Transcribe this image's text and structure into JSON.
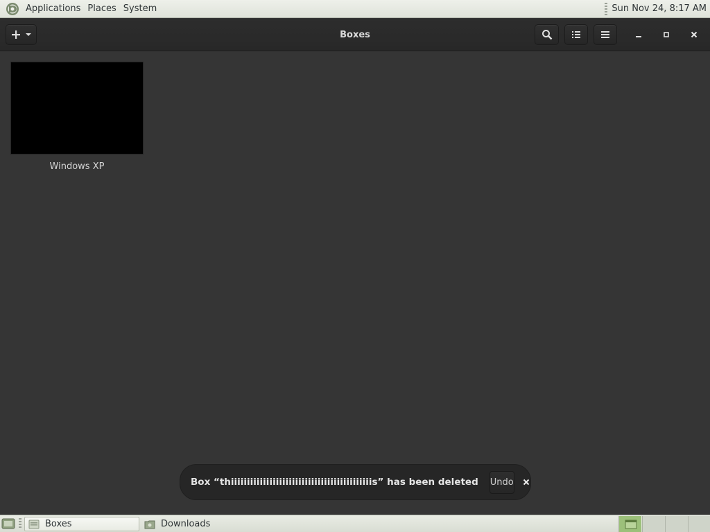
{
  "top_panel": {
    "menus": [
      "Applications",
      "Places",
      "System"
    ],
    "clock": "Sun Nov 24,  8:17 AM"
  },
  "headerbar": {
    "title": "Boxes",
    "new_button_icon": "plus-icon",
    "icons": [
      "search-icon",
      "list-view-icon",
      "hamburger-menu-icon"
    ],
    "window_controls": [
      "minimize-icon",
      "maximize-icon",
      "close-icon"
    ]
  },
  "boxes": [
    {
      "name": "Windows XP"
    }
  ],
  "notification": {
    "message": "Box “thiiiiiiiiiiiiiiiiiiiiiiiiiiiiiiiiiiiiiiiiiiiis” has been deleted",
    "undo_label": "Undo"
  },
  "taskbar": {
    "tasks": [
      {
        "label": "Boxes",
        "active": true
      },
      {
        "label": "Downloads",
        "active": false
      }
    ]
  },
  "colors": {
    "background": "#353535",
    "headerbar": "#2b2b2b",
    "panel": "#e4e7df",
    "workspace_active": "#9cc07a"
  }
}
